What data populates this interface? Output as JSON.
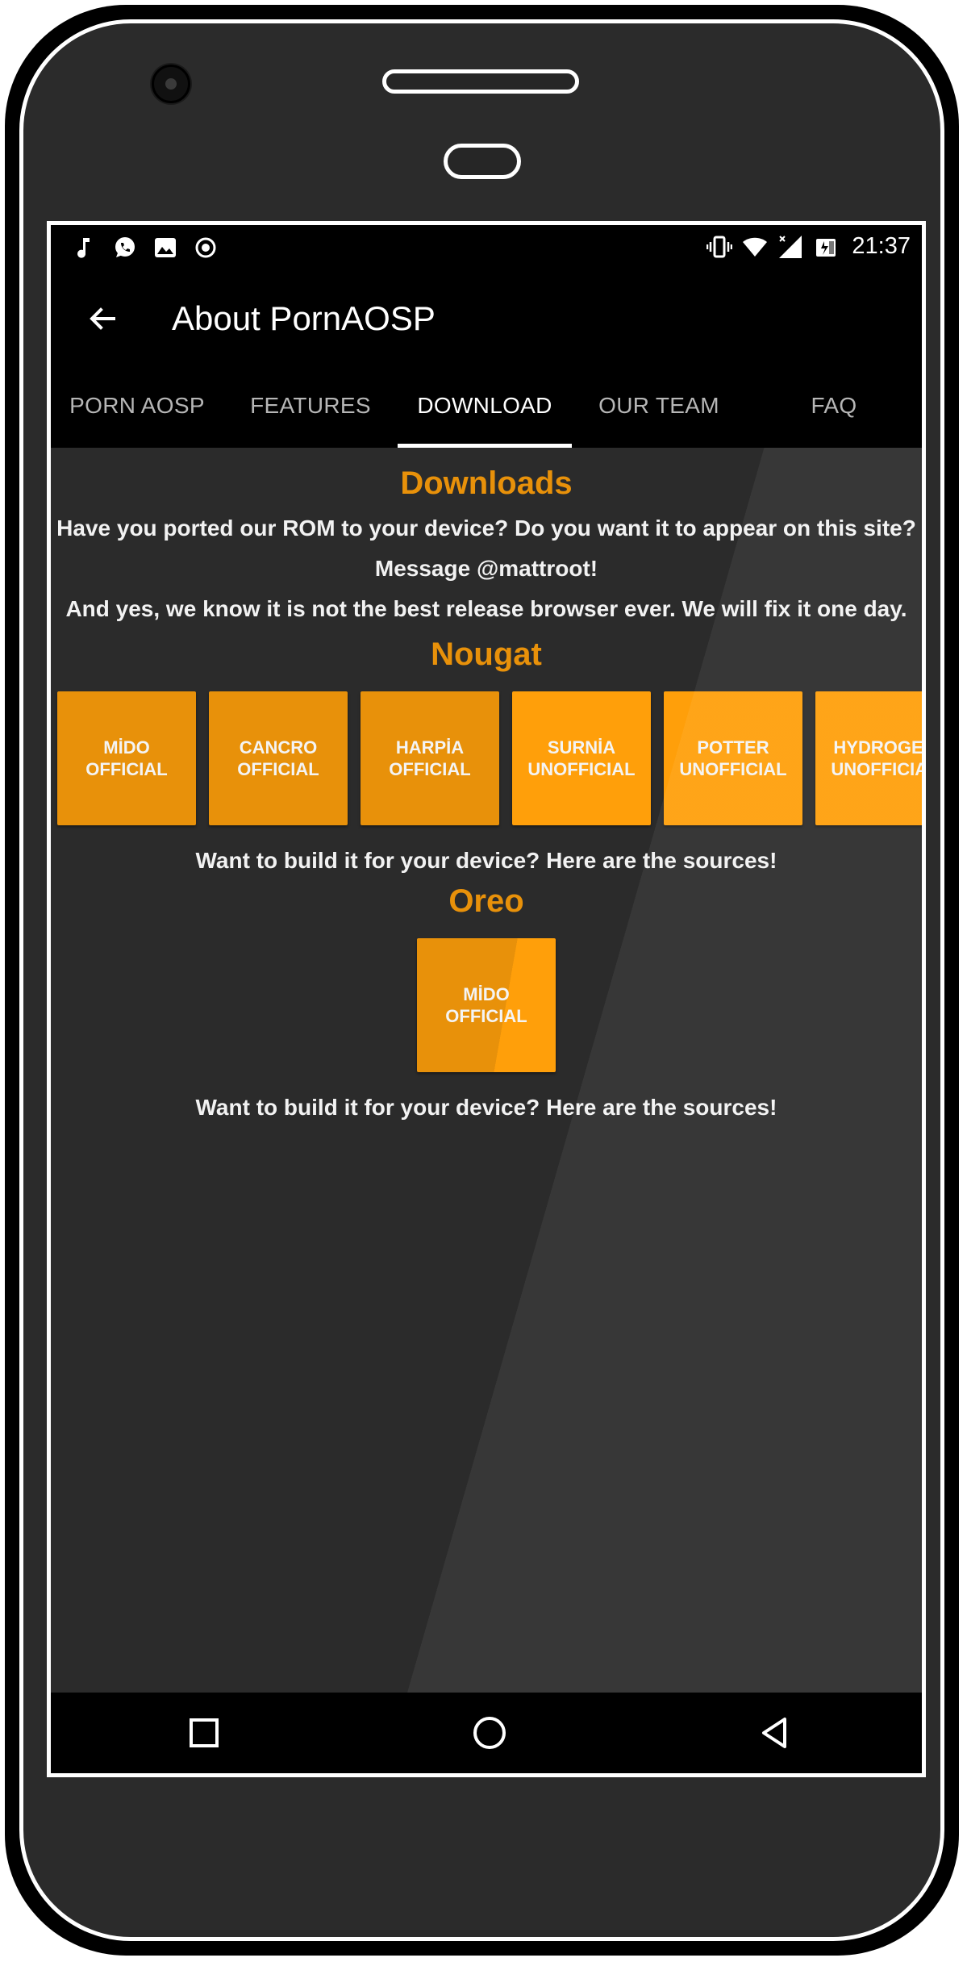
{
  "statusbar": {
    "left_icons": [
      "music-note-icon",
      "whatsapp-icon",
      "image-icon",
      "record-icon"
    ],
    "right_icons": [
      "vibrate-icon",
      "wifi-icon",
      "signal-icon",
      "battery-icon"
    ],
    "time": "21:37"
  },
  "appbar": {
    "title": "About PornAOSP",
    "back_icon": "arrow-left-icon"
  },
  "tabs": [
    {
      "label": "PORN AOSP",
      "active": false
    },
    {
      "label": "FEATURES",
      "active": false
    },
    {
      "label": "DOWNLOAD",
      "active": true
    },
    {
      "label": "OUR TEAM",
      "active": false
    },
    {
      "label": "FAQ",
      "active": false
    }
  ],
  "downloads": {
    "title": "Downloads",
    "line1": "Have you ported our ROM to your device? Do you want it to appear on this site?",
    "line2": "Message @mattroot!",
    "line3": "And yes, we know it is not the best release browser ever. We will fix it one day."
  },
  "nougat": {
    "title": "Nougat",
    "devices": [
      {
        "name": "MİDO",
        "status": "OFFICIAL"
      },
      {
        "name": "CANCRO",
        "status": "OFFICIAL"
      },
      {
        "name": "HARPİA",
        "status": "OFFICIAL"
      },
      {
        "name": "SURNİA",
        "status": "UNOFFICIAL"
      },
      {
        "name": "POTTER",
        "status": "UNOFFICIAL"
      },
      {
        "name": "HYDROGEN",
        "status": "UNOFFICIAL"
      }
    ],
    "sources_text": "Want to build it for your device? Here are the sources!"
  },
  "oreo": {
    "title": "Oreo",
    "devices": [
      {
        "name": "MİDO",
        "status": "OFFICIAL"
      }
    ],
    "sources_text": "Want to build it for your device? Here are the sources!"
  },
  "navbar": {
    "icons": [
      "recents-square-icon",
      "home-circle-icon",
      "back-triangle-icon"
    ]
  },
  "colors": {
    "accent": "#e8910a",
    "accent_bright": "#ff9f0a",
    "background": "#2b2b2b",
    "bars": "#000000"
  }
}
